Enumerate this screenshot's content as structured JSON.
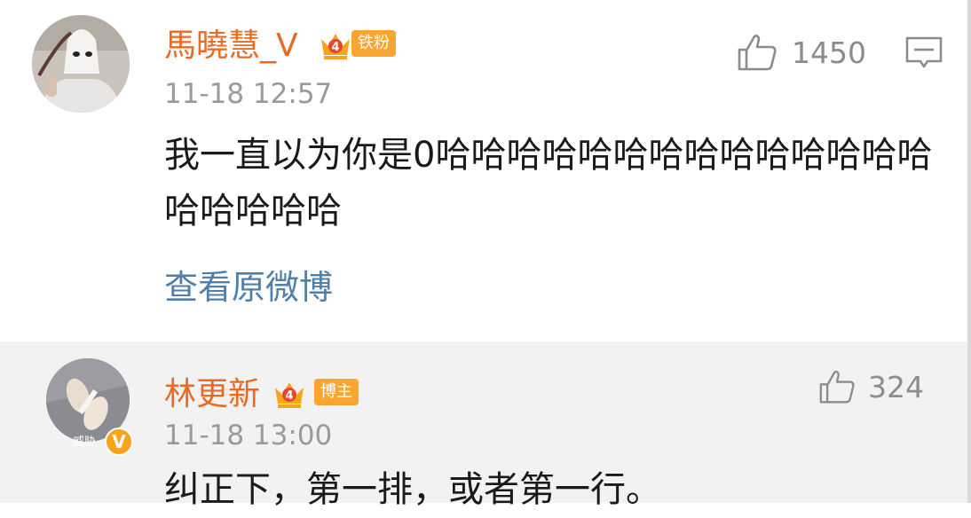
{
  "comments": [
    {
      "username": "馬曉慧_V",
      "badge": "铁粉",
      "crown_level": "4",
      "time": "11-18 12:57",
      "likes": "1450",
      "text": "我一直以为你是0哈哈哈哈哈哈哈哈哈哈哈哈哈哈哈哈哈哈哈",
      "view_original": "查看原微博"
    },
    {
      "username": "林更新",
      "badge": "博主",
      "crown_level": "4",
      "time": "11-18 13:00",
      "likes": "324",
      "text": "纠正下，第一排，或者第一行。",
      "avatar_caption": "威胁",
      "verified_mark": "V"
    }
  ],
  "colors": {
    "username": "#e86b21",
    "badge": "#f9a532",
    "link": "#4f7fab",
    "meta": "#9a9a9a"
  },
  "icons": [
    "thumbs-up-icon",
    "comment-reply-icon",
    "crown-icon",
    "verified-icon"
  ]
}
